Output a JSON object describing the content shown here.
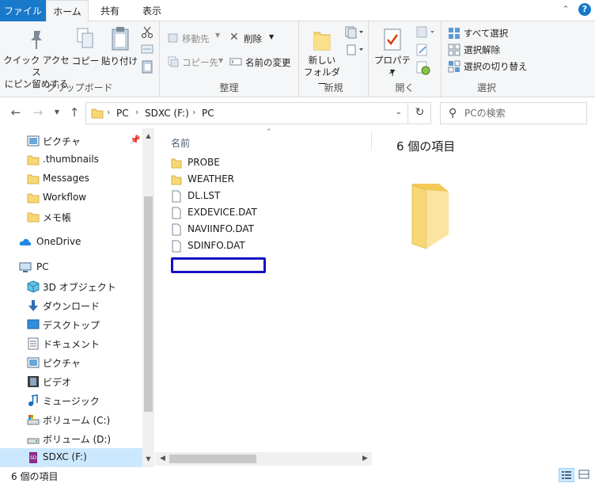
{
  "ribbon_tabs": {
    "file": "ファイル",
    "home": "ホーム",
    "share": "共有",
    "view": "表示",
    "help": "?"
  },
  "clipboard": {
    "pin_quick_access_line1": "クイック アクセス",
    "pin_quick_access_line2": "にピン留めする",
    "copy": "コピー",
    "paste": "貼り付け",
    "group_label": "クリップボード"
  },
  "organize": {
    "move_to": "移動先",
    "copy_to": "コピー先",
    "delete": "削除",
    "rename": "名前の変更",
    "group_label": "整理"
  },
  "new_group": {
    "new_folder_line1": "新しい",
    "new_folder_line2": "フォルダー",
    "group_label": "新規"
  },
  "open_group": {
    "properties": "プロパティ",
    "group_label": "開く"
  },
  "select_group": {
    "select_all": "すべて選択",
    "select_none": "選択解除",
    "invert_selection": "選択の切り替え",
    "group_label": "選択"
  },
  "address": {
    "crumbs": [
      "PC",
      "SDXC (F:)",
      "PC"
    ],
    "search_placeholder": "PCの検索"
  },
  "sidebar": {
    "items": [
      {
        "label": "ピクチャ",
        "icon": "pictures-icon",
        "pinned": true
      },
      {
        "label": ".thumbnails",
        "icon": "folder-icon"
      },
      {
        "label": "Messages",
        "icon": "folder-icon"
      },
      {
        "label": "Workflow",
        "icon": "folder-icon"
      },
      {
        "label": "メモ帳",
        "icon": "folder-icon"
      },
      {
        "label": "OneDrive",
        "icon": "cloud-icon"
      },
      {
        "label": "PC",
        "icon": "pc-icon"
      },
      {
        "label": "3D オブジェクト",
        "icon": "cube-icon"
      },
      {
        "label": "ダウンロード",
        "icon": "download-icon"
      },
      {
        "label": "デスクトップ",
        "icon": "desktop-icon"
      },
      {
        "label": "ドキュメント",
        "icon": "document-icon"
      },
      {
        "label": "ピクチャ",
        "icon": "pictures-icon"
      },
      {
        "label": "ビデオ",
        "icon": "video-icon"
      },
      {
        "label": "ミュージック",
        "icon": "music-icon"
      },
      {
        "label": "ボリューム (C:)",
        "icon": "drive-c-icon"
      },
      {
        "label": "ボリューム (D:)",
        "icon": "drive-icon"
      },
      {
        "label": "SDXC (F:)",
        "icon": "sd-card-icon",
        "selected": true
      }
    ]
  },
  "filelist": {
    "column_name": "名前",
    "files": [
      {
        "name": "PROBE",
        "type": "folder"
      },
      {
        "name": "WEATHER",
        "type": "folder"
      },
      {
        "name": "DL.LST",
        "type": "file"
      },
      {
        "name": "EXDEVICE.DAT",
        "type": "file"
      },
      {
        "name": "NAVIINFO.DAT",
        "type": "file"
      },
      {
        "name": "SDINFO.DAT",
        "type": "file"
      }
    ]
  },
  "preview": {
    "title": "6 個の項目"
  },
  "status": {
    "item_count": "6 個の項目"
  },
  "colors": {
    "accent": "#1979ca",
    "folder": "#f8d775",
    "selection": "#cce8ff",
    "rename_border": "#1512c4"
  }
}
